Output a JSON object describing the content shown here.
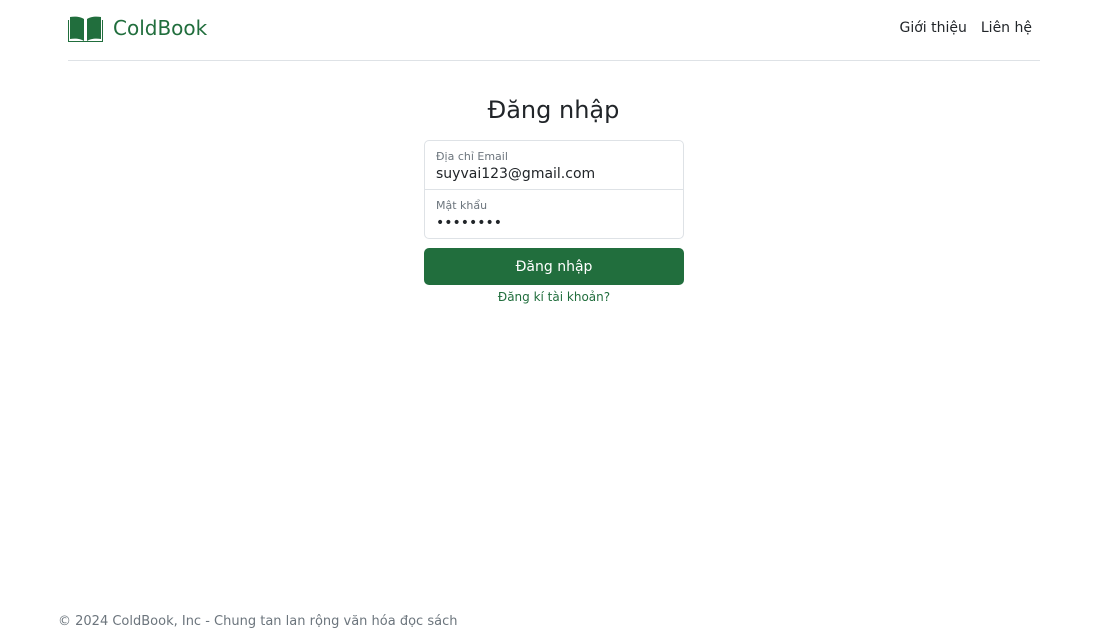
{
  "brand": {
    "name": "ColdBook",
    "color": "#216e3d"
  },
  "nav": [
    {
      "label": "Giới thiệu"
    },
    {
      "label": "Liên hệ"
    }
  ],
  "login": {
    "title": "Đăng nhập",
    "email_label": "Địa chỉ Email",
    "email_value": "suyvai123@gmail.com",
    "password_label": "Mật khẩu",
    "password_value": "••••••••",
    "submit_label": "Đăng nhập",
    "register_link": "Đăng kí tài khoản?"
  },
  "footer": {
    "text": "© 2024 ColdBook, Inc - Chung tan lan rộng văn hóa đọc sách"
  },
  "icons": {
    "brand": "open-book-icon"
  }
}
